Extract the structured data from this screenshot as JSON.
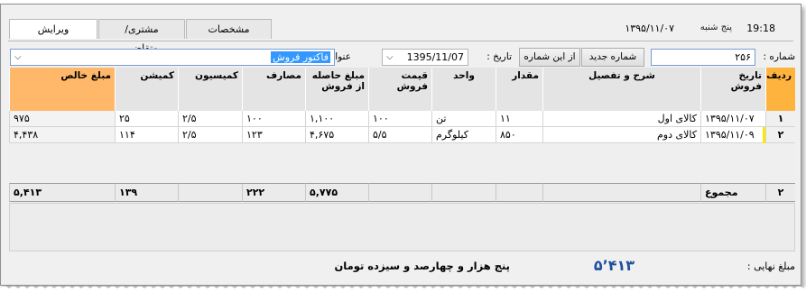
{
  "header": {
    "time": "19:18",
    "day_name": "پنج شنبه",
    "date": "۱۳۹۵/۱۱/۰۷",
    "tabs": [
      {
        "label": "مشخصات",
        "active": false
      },
      {
        "label": "مشتری/متقاضی",
        "active": false
      },
      {
        "label": "ویرایش",
        "active": true
      }
    ]
  },
  "toolbar": {
    "number_label": "شماره :",
    "number_value": "۲۵۶",
    "new_number_button": "شماره جدید",
    "from_this_number_button": "از این شماره",
    "date_label": "تاریخ :",
    "date_value": "1395/11/07",
    "title_label": "عنوان :",
    "title_value": "فاکتور فروش"
  },
  "grid": {
    "columns": [
      "ردیف",
      "تاریخ فروش",
      "شرح و تفصیل",
      "مقدار",
      "واحد",
      "قیمت فروش",
      "مبلغ حاصله از فروش",
      "مصارف",
      "کمیسیون",
      "کمیشن",
      "مبلغ خالص"
    ],
    "rows": [
      {
        "row": "۱",
        "date": "۱۳۹۵/۱۱/۰۷",
        "desc": "کالای اول",
        "qty": "۱۱",
        "unit": "تن",
        "price": "۱۰۰",
        "gross": "۱,۱۰۰",
        "expense": "۱۰۰",
        "commission_rate": "۲/۵",
        "commission": "۲۵",
        "net": "۹۷۵"
      },
      {
        "row": "۲",
        "date": "۱۳۹۵/۱۱/۰۹",
        "desc": "کالای دوم",
        "qty": "۸۵۰",
        "unit": "کیلوگرم",
        "price": "۵/۵",
        "gross": "۴,۶۷۵",
        "expense": "۱۲۳",
        "commission_rate": "۲/۵",
        "commission": "۱۱۴",
        "net": "۴,۴۳۸"
      }
    ],
    "totals": {
      "count": "۲",
      "label": "مجموع",
      "gross": "۵,۷۷۵",
      "expense": "۲۲۲",
      "commission": "۱۳۹",
      "net": "۵,۴۱۳"
    }
  },
  "footer": {
    "final_label": "مبلغ نهایی :",
    "final_amount": "۵٬۴۱۳",
    "final_words": "پنج هزار و چهارصد و سیزده تومان"
  },
  "colors": {
    "row_header": "#ffb33f",
    "net_header": "#ffb869",
    "final_amount": "#1f4f9e",
    "selection": "#3399ff"
  }
}
